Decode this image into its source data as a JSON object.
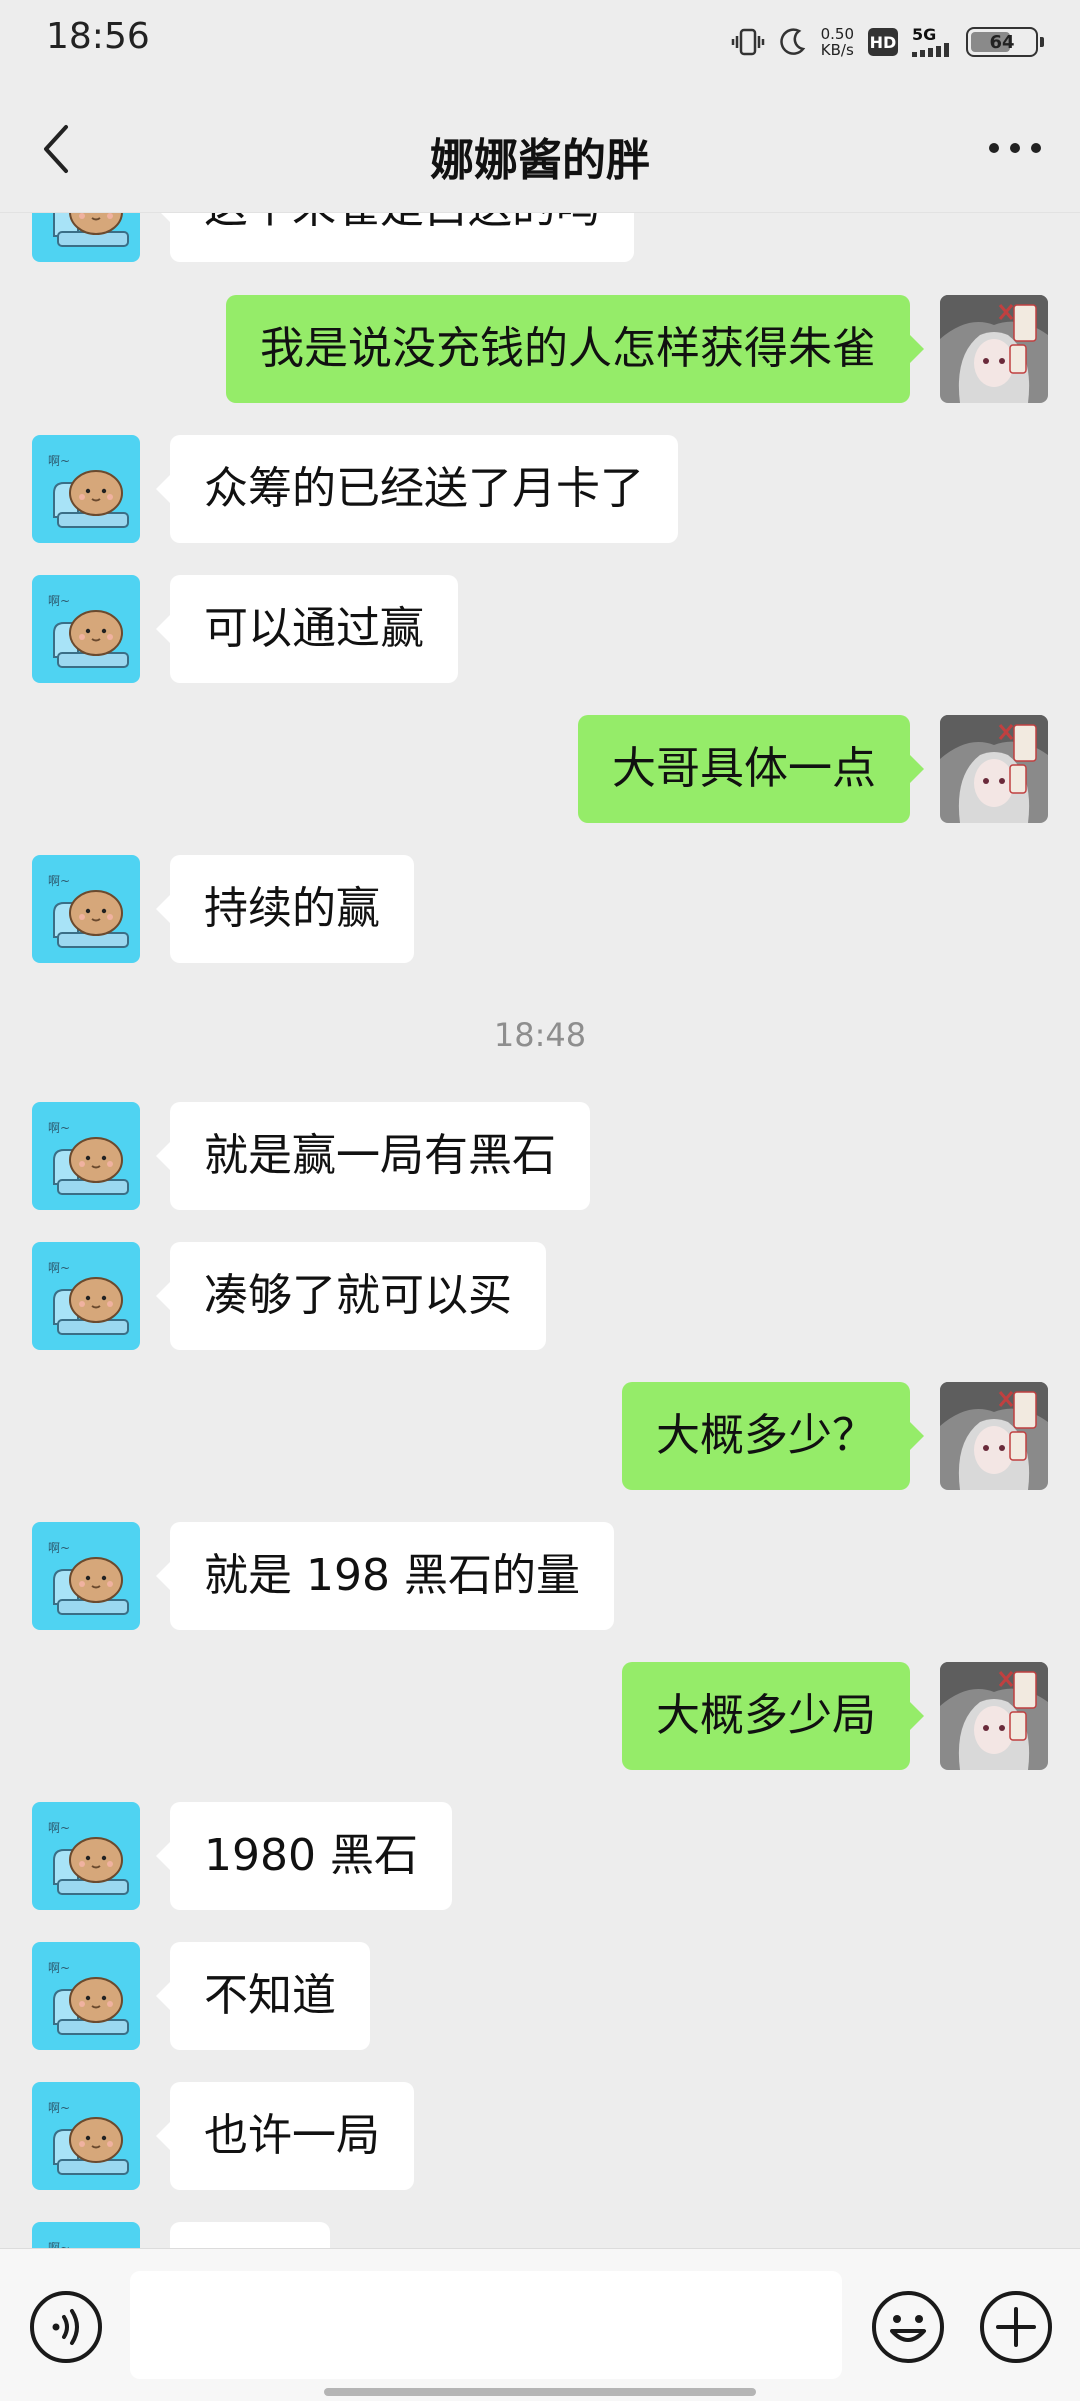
{
  "status_bar": {
    "time": "18:56",
    "net_speed_value": "0.50",
    "net_speed_unit": "KB/s",
    "hd_label": "HD",
    "network_label": "5G",
    "battery_level": "64"
  },
  "header": {
    "title": "娜娜酱的胖"
  },
  "messages": [
    {
      "side": "left",
      "text": "这个朱雀是白送的吗"
    },
    {
      "side": "right",
      "text": "我是说没充钱的人怎样获得朱雀"
    },
    {
      "side": "left",
      "text": "众筹的已经送了月卡了"
    },
    {
      "side": "left",
      "text": "可以通过赢"
    },
    {
      "side": "right",
      "text": "大哥具体一点"
    },
    {
      "side": "left",
      "text": "持续的赢"
    },
    {
      "side": "left",
      "text": "就是赢一局有黑石"
    },
    {
      "side": "left",
      "text": "凑够了就可以买"
    },
    {
      "side": "right",
      "text": "大概多少？"
    },
    {
      "side": "left",
      "text": "就是 198 黑石的量"
    },
    {
      "side": "right",
      "text": "大概多少局"
    },
    {
      "side": "left",
      "text": "1980 黑石"
    },
    {
      "side": "left",
      "text": "不知道"
    },
    {
      "side": "left",
      "text": "也许一局"
    },
    {
      "side": "left",
      "text": ""
    }
  ],
  "timestamp": "18:48",
  "input": {
    "value": ""
  },
  "colors": {
    "background": "#EDEDED",
    "incoming_bubble": "#FFFFFF",
    "outgoing_bubble": "#95EC69",
    "contact_avatar": "#4FD3F2"
  },
  "icons": {
    "back": "chevron-left-icon",
    "more": "more-dots-icon",
    "voice": "voice-icon",
    "emoji": "emoji-icon",
    "plus": "plus-icon"
  }
}
